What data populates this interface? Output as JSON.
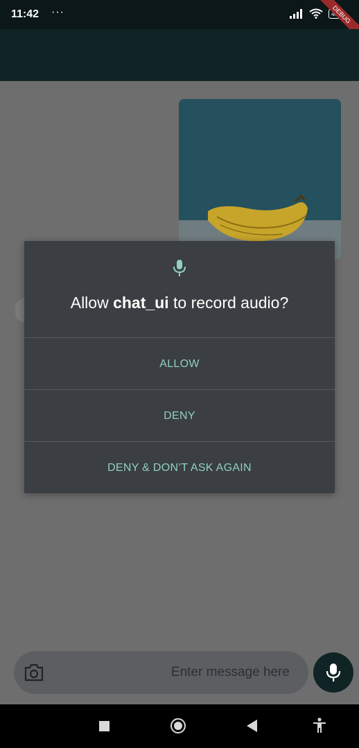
{
  "status_bar": {
    "time": "11:42",
    "dots": "···",
    "battery": "48",
    "debug_label": "DEBUG"
  },
  "dialog": {
    "title_prefix": "Allow ",
    "app_name": "chat_ui",
    "title_suffix": " to record audio?",
    "allow_label": "ALLOW",
    "deny_label": "DENY",
    "deny_never_label": "DENY & DON’T ASK AGAIN"
  },
  "composer": {
    "placeholder": "Enter message here"
  },
  "colors": {
    "accent_teal": "#8fd0c3",
    "app_bar": "#102425",
    "dialog_bg": "#3b3e42"
  },
  "icons": {
    "dialog": "microphone-icon",
    "camera": "camera-icon",
    "fab": "microphone-icon",
    "nav": [
      "stop-square-icon",
      "home-circle-icon",
      "back-triangle-icon",
      "accessibility-icon"
    ]
  }
}
